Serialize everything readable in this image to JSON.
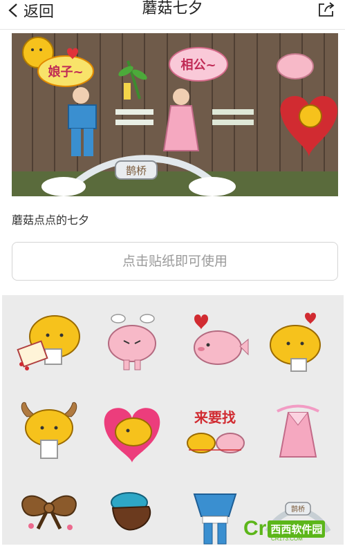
{
  "nav": {
    "back_label": "返回",
    "title": "蘑菇七夕",
    "share_icon": "share-icon"
  },
  "banner": {
    "stickers": [
      "娘子~",
      "相公~",
      "鹊桥"
    ],
    "alt_icons": [
      "mushroom-moon-icon",
      "heart-icon",
      "bamboo-icon",
      "bridge-icon"
    ]
  },
  "caption": "蘑菇点点的七夕",
  "use_button": "点击贴纸即可使用",
  "stickers": [
    {
      "name": "mushroom-love-letter-sticker",
      "text": ""
    },
    {
      "name": "pink-pig-steam-sticker",
      "text": ""
    },
    {
      "name": "pink-fish-heart-sticker",
      "text": ""
    },
    {
      "name": "mushroom-heart-sticker",
      "text": ""
    },
    {
      "name": "mushroom-horns-sticker",
      "text": ""
    },
    {
      "name": "mushroom-big-heart-sticker",
      "text": ""
    },
    {
      "name": "come-find-elephants-sticker",
      "text": "来要找"
    },
    {
      "name": "pink-dress-sticker",
      "text": ""
    },
    {
      "name": "brown-bow-sticker",
      "text": ""
    },
    {
      "name": "blue-hat-hair-sticker",
      "text": ""
    },
    {
      "name": "blue-outfit-sticker",
      "text": ""
    },
    {
      "name": "bridge-sticker",
      "text": "鹊桥"
    }
  ],
  "watermark": {
    "brand": "西西软件园",
    "url": "CR173.COM",
    "letter": "Cr"
  },
  "colors": {
    "accent": "#5cb61a",
    "sticker_yellow": "#f6c21c",
    "sticker_pink": "#f7b9c8",
    "sticker_blue": "#3a8fd0"
  }
}
